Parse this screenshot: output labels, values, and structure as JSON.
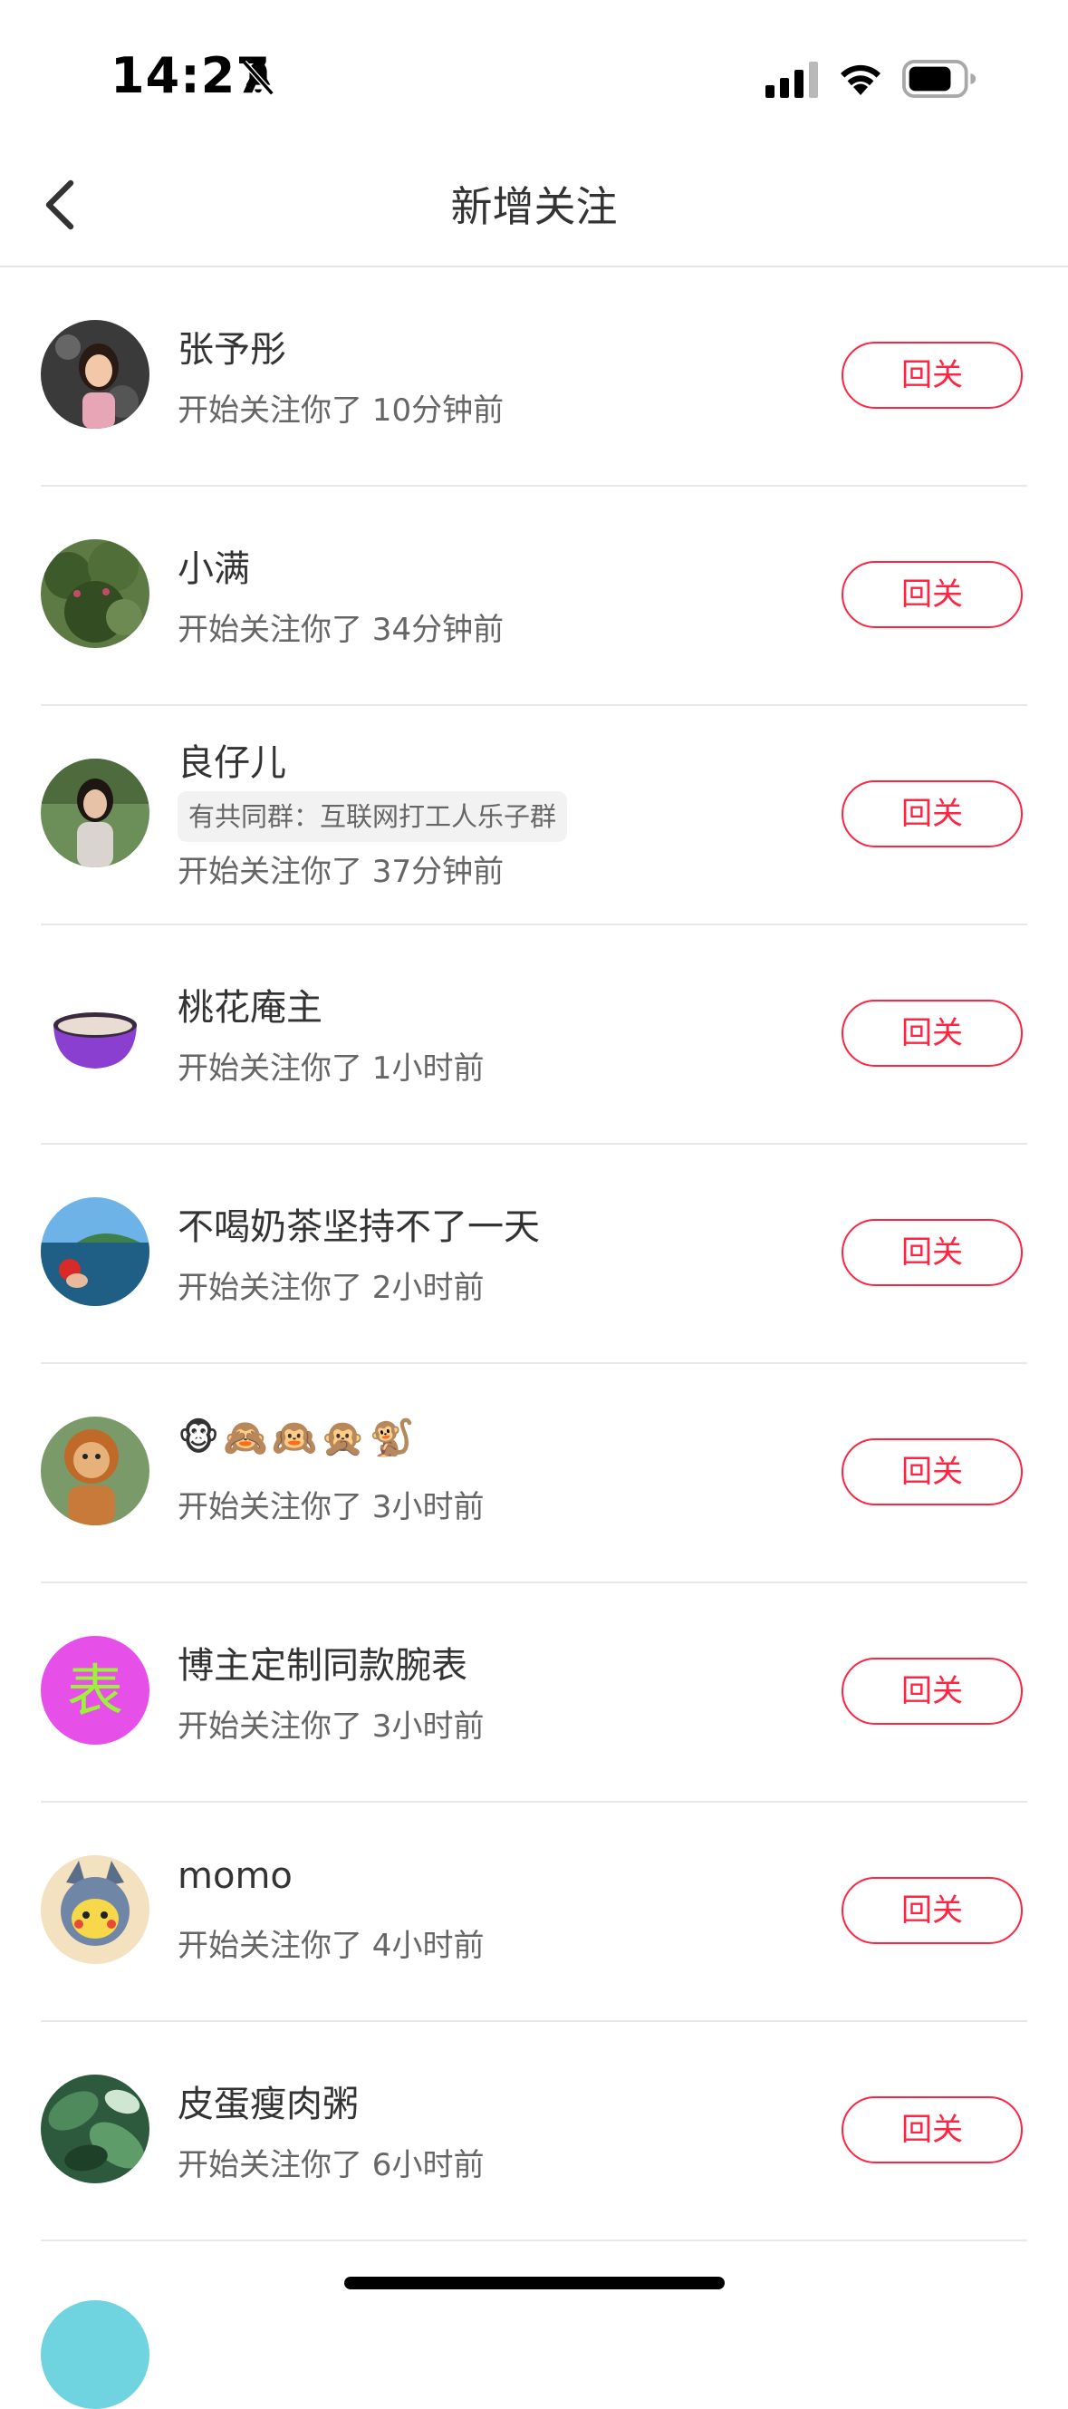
{
  "status": {
    "time": "14:27",
    "bell_icon": "bell-slash-icon",
    "signal_icon": "cellular-signal-icon",
    "wifi_icon": "wifi-icon",
    "battery_icon": "battery-icon"
  },
  "nav": {
    "title": "新增关注",
    "back_icon": "chevron-left-icon"
  },
  "follow_label": "回关",
  "items": [
    {
      "name": "张予彤",
      "sub": "开始关注你了 10分钟前"
    },
    {
      "name": "小满",
      "sub": "开始关注你了 34分钟前"
    },
    {
      "name": "良仔儿",
      "tag": "有共同群：互联网打工人乐子群",
      "sub": "开始关注你了 37分钟前"
    },
    {
      "name": "桃花庵主",
      "sub": "开始关注你了 1小时前"
    },
    {
      "name": "不喝奶茶坚持不了一天",
      "sub": "开始关注你了 2小时前"
    },
    {
      "name": "🐵🙈🙉🙊🐒",
      "sub": "开始关注你了 3小时前"
    },
    {
      "name": "博主定制同款腕表",
      "sub": "开始关注你了 3小时前",
      "avatar_text": "表"
    },
    {
      "name": "momo",
      "sub": "开始关注你了 4小时前"
    },
    {
      "name": "皮蛋瘦肉粥",
      "sub": "开始关注你了 6小时前"
    }
  ],
  "colors": {
    "accent": "#ff2442",
    "text_primary": "#333333",
    "text_secondary": "#666666",
    "divider": "#e8e8e8"
  }
}
